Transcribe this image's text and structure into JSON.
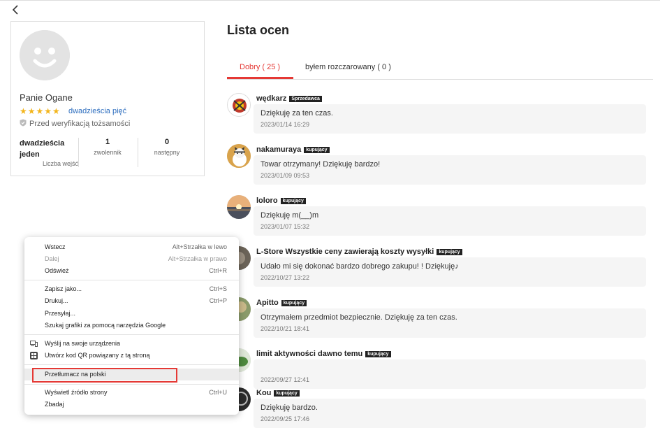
{
  "profile": {
    "name": "Panie Ogane",
    "stars": "★★★★★",
    "rating_link": "dwadzieścia pięć",
    "verification": "Przed weryfikacją tożsamości",
    "stats": [
      {
        "value": "dwadzieścia jeden",
        "label": "Liczba wejść"
      },
      {
        "value": "1",
        "label": "zwolennik"
      },
      {
        "value": "0",
        "label": "następny"
      }
    ]
  },
  "main": {
    "title": "Lista ocen",
    "tabs": [
      {
        "label": "Dobry ( 25 )",
        "active": true
      },
      {
        "label": "byłem rozczarowany ( 0 )",
        "active": false
      }
    ]
  },
  "reviews": [
    {
      "name": "wędkarz",
      "badge": "Sprzedawca",
      "text": "Dziękuję za ten czas.",
      "date": "2023/01/14 16:29"
    },
    {
      "name": "nakamuraya",
      "badge": "kupujący",
      "text": "Towar otrzymany! Dziękuję bardzo!",
      "date": "2023/01/09 09:53"
    },
    {
      "name": "loloro",
      "badge": "kupujący",
      "text": "Dziękuję m(__)m",
      "date": "2023/01/07 15:32"
    },
    {
      "name": "L-Store Wszystkie ceny zawierają koszty wysyłki",
      "badge": "kupujący",
      "text": "Udało mi się dokonać bardzo dobrego zakupu! ! Dziękuję♪",
      "date": "2022/10/27 13:22"
    },
    {
      "name": "Apitto",
      "badge": "kupujący",
      "text": "Otrzymałem przedmiot bezpiecznie. Dziękuję za ten czas.",
      "date": "2022/10/21 18:41"
    },
    {
      "name": "limit aktywności dawno temu",
      "badge": "kupujący",
      "text": "",
      "date": "2022/09/27 12:41"
    },
    {
      "name": "Kou",
      "badge": "kupujący",
      "text": "Dziękuję bardzo.",
      "date": "2022/09/25 17:46"
    }
  ],
  "context_menu": {
    "items": [
      {
        "label": "Wstecz",
        "shortcut": "Alt+Strzałka w lewo",
        "disabled": false
      },
      {
        "label": "Dalej",
        "shortcut": "Alt+Strzałka w prawo",
        "disabled": true
      },
      {
        "label": "Odśwież",
        "shortcut": "Ctrl+R",
        "disabled": false
      },
      {
        "label": "Zapisz jako...",
        "shortcut": "Ctrl+S",
        "disabled": false
      },
      {
        "label": "Drukuj...",
        "shortcut": "Ctrl+P",
        "disabled": false
      },
      {
        "label": "Przesyłaj...",
        "shortcut": "",
        "disabled": false
      },
      {
        "label": "Szukaj grafiki za pomocą narzędzia Google",
        "shortcut": "",
        "disabled": false
      },
      {
        "label": "Wyślij na swoje urządzenia",
        "shortcut": "",
        "disabled": false
      },
      {
        "label": "Utwórz kod QR powiązany z tą stroną",
        "shortcut": "",
        "disabled": false
      },
      {
        "label": "Przetłumacz na polski",
        "shortcut": "",
        "disabled": false
      },
      {
        "label": "Wyświetl źródło strony",
        "shortcut": "Ctrl+U",
        "disabled": false
      },
      {
        "label": "Zbadaj",
        "shortcut": "",
        "disabled": false
      }
    ]
  },
  "colors": {
    "accent": "#e53935",
    "star": "#f3b51c",
    "link": "#2f6fbf"
  },
  "icons": [
    "back-chevron-icon",
    "shield-check-icon",
    "device-icon",
    "qr-code-icon",
    "star-icon"
  ]
}
